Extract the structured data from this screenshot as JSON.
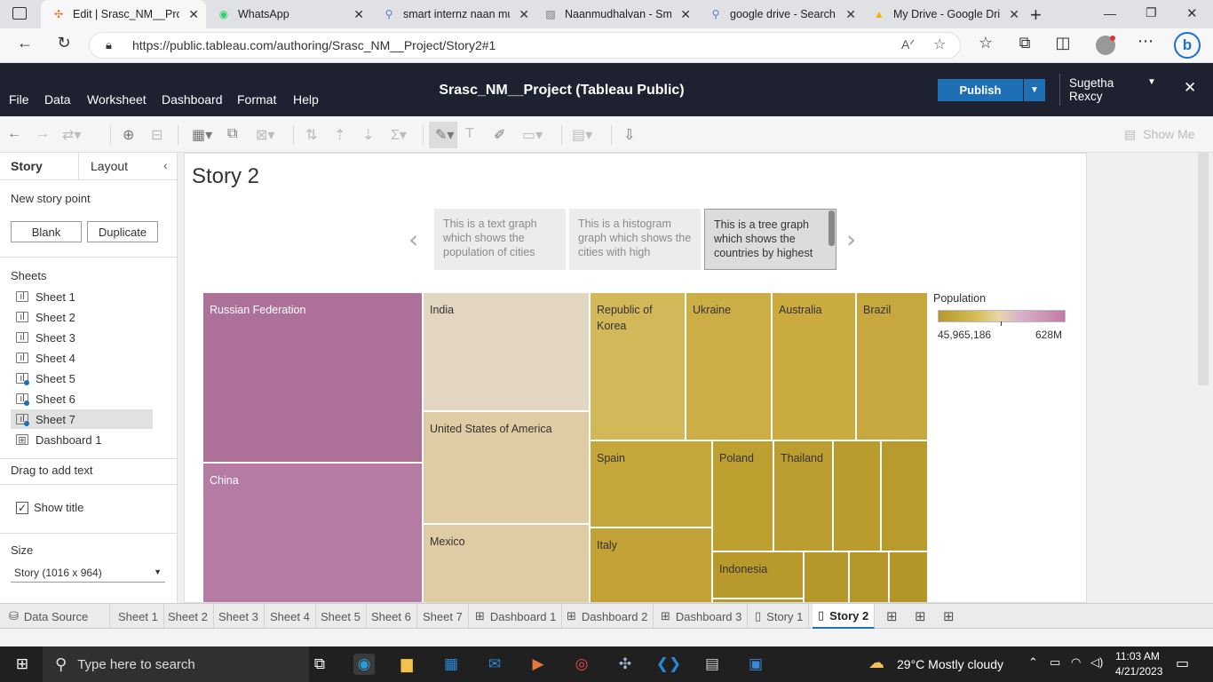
{
  "browser": {
    "tabs": [
      {
        "title": "Edit | Srasc_NM__Proje",
        "icon": "tableau-icon",
        "active": true
      },
      {
        "title": "WhatsApp",
        "icon": "whatsapp-icon"
      },
      {
        "title": "smart internz naan mu",
        "icon": "search-icon"
      },
      {
        "title": "Naanmudhalvan - Sma",
        "icon": "image-icon"
      },
      {
        "title": "google drive - Search",
        "icon": "search-icon"
      },
      {
        "title": "My Drive - Google Dri",
        "icon": "google-drive-icon"
      }
    ],
    "url": "https://public.tableau.com/authoring/Srasc_NM__Project/Story2#1"
  },
  "app": {
    "menus": [
      "File",
      "Data",
      "Worksheet",
      "Dashboard",
      "Format",
      "Help"
    ],
    "title": "Srasc_NM__Project (Tableau Public)",
    "publish": "Publish",
    "user_first": "Sugetha",
    "user_last": "Rexcy",
    "show_me": "Show Me"
  },
  "leftpane": {
    "tab_story": "Story",
    "tab_layout": "Layout",
    "new_story_point": "New story point",
    "blank": "Blank",
    "duplicate": "Duplicate",
    "sheets_heading": "Sheets",
    "sheets": [
      "Sheet 1",
      "Sheet 2",
      "Sheet 3",
      "Sheet 4",
      "Sheet 5",
      "Sheet 6",
      "Sheet 7",
      "Dashboard 1"
    ],
    "drag_text": "Drag to add text",
    "show_title": "Show title",
    "size_heading": "Size",
    "size_value": "Story (1016 x 964)"
  },
  "story": {
    "title": "Story 2",
    "points": [
      "This is a text graph which shows the population of cities",
      "This is a histogram graph which shows the cities with high",
      "This is a tree graph which shows the countries by highest"
    ]
  },
  "treemap": {
    "legend_title": "Population",
    "legend_min": "45,965,186",
    "legend_max": "628M",
    "colors": {
      "purple_dark": "#ad7199",
      "purple": "#b67ba3",
      "beige": "#e2d5c2",
      "tan": "#e0cca4",
      "gold": "#d3b85a",
      "gold_mid": "#c9a93e",
      "gold_dark": "#b89a2c"
    },
    "cells": [
      {
        "label": "Russian Federation"
      },
      {
        "label": "China"
      },
      {
        "label": "India"
      },
      {
        "label": "United States of America"
      },
      {
        "label": "Mexico"
      },
      {
        "label": "Republic of Korea"
      },
      {
        "label": "Ukraine"
      },
      {
        "label": "Australia"
      },
      {
        "label": "Brazil"
      },
      {
        "label": "Spain"
      },
      {
        "label": "Poland"
      },
      {
        "label": "Thailand"
      },
      {
        "label": "Italy"
      },
      {
        "label": "Indonesia"
      }
    ]
  },
  "bottom_tabs": [
    "Data Source",
    "Sheet 1",
    "Sheet 2",
    "Sheet 3",
    "Sheet 4",
    "Sheet 5",
    "Sheet 6",
    "Sheet 7",
    "Dashboard 1",
    "Dashboard 2",
    "Dashboard 3",
    "Story 1",
    "Story 2"
  ],
  "taskbar": {
    "search_placeholder": "Type here to search",
    "weather": "29°C  Mostly cloudy",
    "time": "11:03 AM",
    "date": "4/21/2023"
  }
}
